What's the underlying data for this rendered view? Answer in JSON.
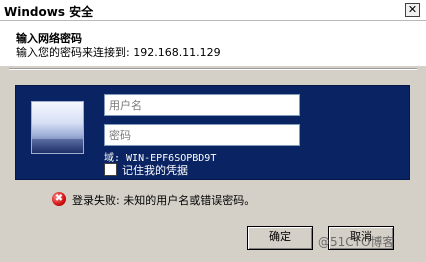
{
  "window": {
    "title": "Windows 安全",
    "close_glyph": "✕"
  },
  "header": {
    "title": "输入网络密码",
    "subtitle": "输入您的密码来连接到: 192.168.11.129"
  },
  "credentials": {
    "username_placeholder": "用户名",
    "password_placeholder": "密码",
    "domain_label": "域: WIN-EPF6SOPBD9T",
    "remember_label": "记住我的凭据",
    "remember_checked": false
  },
  "error": {
    "icon": "error-icon",
    "icon_glyph": "✖",
    "message": "登录失败: 未知的用户名或错误密码。"
  },
  "buttons": {
    "ok_label": "确定",
    "cancel_label": "取消"
  },
  "watermark": "@51CTO博客",
  "colors": {
    "panel_background": "#0a2463",
    "dialog_background": "#d4d0c8"
  }
}
